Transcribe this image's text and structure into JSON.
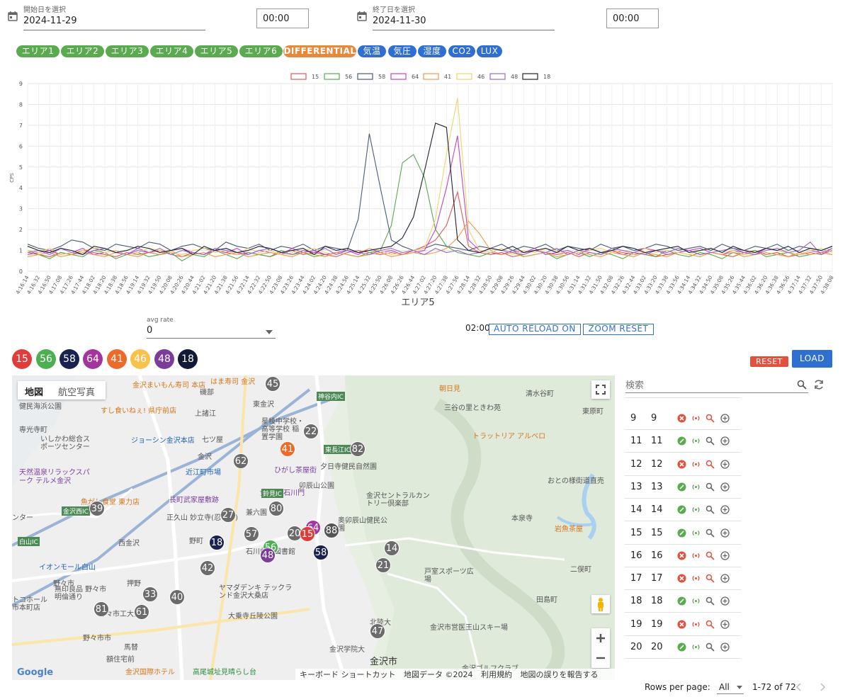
{
  "filters": {
    "start": {
      "label": "開始日を選択",
      "date": "2024-11-29",
      "time": "00:00"
    },
    "end": {
      "label": "終了日を選択",
      "date": "2024-11-30",
      "time": "00:00"
    }
  },
  "chips": [
    {
      "label": "エリア1",
      "color": "#5aaa4f"
    },
    {
      "label": "エリア2",
      "color": "#5aaa4f"
    },
    {
      "label": "エリア3",
      "color": "#5aaa4f"
    },
    {
      "label": "エリア4",
      "color": "#5aaa4f"
    },
    {
      "label": "エリア5",
      "color": "#5aaa4f"
    },
    {
      "label": "エリア6",
      "color": "#5aaa4f"
    },
    {
      "label": "DIFFERENTIAL",
      "color": "#e8893a"
    },
    {
      "label": "気温",
      "color": "#2f6fd0"
    },
    {
      "label": "気圧",
      "color": "#2f6fd0"
    },
    {
      "label": "湿度",
      "color": "#2f6fd0"
    },
    {
      "label": "CO2",
      "color": "#2f6fd0"
    },
    {
      "label": "LUX",
      "color": "#2f6fd0"
    }
  ],
  "chart_data": {
    "type": "line",
    "title": "",
    "xlabel": "エリア5",
    "ylabel": "CPS",
    "ylim": [
      0,
      9
    ],
    "grid": true,
    "legend_position": "top",
    "yticks": [
      0,
      1,
      2,
      3,
      4,
      5,
      6,
      7,
      8,
      9
    ],
    "x": [
      "4:16:14",
      "4:16:32",
      "4:16:50",
      "4:17:08",
      "4:17:26",
      "4:17:44",
      "4:18:02",
      "4:18:20",
      "4:18:38",
      "4:18:56",
      "4:19:14",
      "4:19:32",
      "4:19:50",
      "4:20:08",
      "4:20:26",
      "4:20:44",
      "4:21:02",
      "4:21:20",
      "4:21:38",
      "4:21:56",
      "4:22:14",
      "4:22:32",
      "4:22:50",
      "4:23:08",
      "4:23:26",
      "4:23:44",
      "4:24:02",
      "4:24:20",
      "4:24:38",
      "4:24:56",
      "4:25:14",
      "4:25:32",
      "4:25:50",
      "4:26:08",
      "4:26:26",
      "4:26:44",
      "4:27:02",
      "4:27:20",
      "4:27:38",
      "4:27:56",
      "4:28:14",
      "4:28:32",
      "4:28:50",
      "4:29:08",
      "4:29:26",
      "4:29:44",
      "4:30:02",
      "4:30:20",
      "4:30:38",
      "4:30:56",
      "4:31:14",
      "4:31:32",
      "4:31:50",
      "4:32:08",
      "4:32:26",
      "4:32:44",
      "4:33:02",
      "4:33:20",
      "4:33:38",
      "4:33:56",
      "4:34:14",
      "4:34:32",
      "4:34:50",
      "4:35:08",
      "4:35:26",
      "4:35:44",
      "4:36:02",
      "4:36:20",
      "4:36:38",
      "4:36:56",
      "4:37:14",
      "4:37:32",
      "4:37:50",
      "4:38:08"
    ],
    "series": [
      {
        "name": "15",
        "color": "#e8555a",
        "values": [
          0.9,
          0.8,
          0.7,
          0.9,
          0.8,
          1.0,
          0.9,
          0.8,
          0.7,
          0.9,
          0.8,
          0.9,
          1.0,
          0.8,
          0.7,
          0.9,
          0.8,
          1.0,
          0.9,
          0.8,
          0.9,
          0.8,
          0.7,
          0.9,
          1.0,
          0.8,
          0.9,
          0.8,
          0.7,
          0.9,
          1.0,
          0.9,
          0.8,
          0.9,
          0.8,
          1.0,
          1.2,
          1.5,
          2.2,
          3.8,
          1.2,
          0.9,
          0.8,
          0.9,
          0.7,
          0.8,
          1.0,
          0.9,
          0.8,
          0.9,
          0.7,
          0.9,
          0.8,
          1.0,
          0.9,
          0.8,
          0.9,
          0.7,
          0.8,
          0.9,
          1.0,
          0.8,
          0.9,
          0.8,
          0.7,
          0.9,
          1.0,
          0.8,
          0.9,
          0.7,
          0.8,
          0.9,
          0.8,
          1.0
        ]
      },
      {
        "name": "56",
        "color": "#5aaa4f",
        "values": [
          1.0,
          0.8,
          0.6,
          0.9,
          0.8,
          0.7,
          1.0,
          0.9,
          0.6,
          0.8,
          0.9,
          0.7,
          0.8,
          0.9,
          0.5,
          0.8,
          0.7,
          1.0,
          0.8,
          0.6,
          0.9,
          0.8,
          0.7,
          1.0,
          0.8,
          0.9,
          0.7,
          0.8,
          0.9,
          0.8,
          0.7,
          0.9,
          1.0,
          2.2,
          5.2,
          5.6,
          4.5,
          2.0,
          1.2,
          0.9,
          0.8,
          0.7,
          0.9,
          0.8,
          1.0,
          0.7,
          0.8,
          0.9,
          0.6,
          0.8,
          0.9,
          0.7,
          0.9,
          0.8,
          0.6,
          0.9,
          0.8,
          0.7,
          1.0,
          0.8,
          0.7,
          0.9,
          0.8,
          0.6,
          0.9,
          0.8,
          1.0,
          0.7,
          0.8,
          0.9,
          0.7,
          0.8,
          0.9,
          0.8
        ]
      },
      {
        "name": "58",
        "color": "#4a5a78",
        "values": [
          1.3,
          1.1,
          1.0,
          1.2,
          1.5,
          1.4,
          1.1,
          1.0,
          1.3,
          1.2,
          1.1,
          1.4,
          1.3,
          1.0,
          1.2,
          1.3,
          1.1,
          1.0,
          1.4,
          1.2,
          1.1,
          1.3,
          1.0,
          1.2,
          1.1,
          1.3,
          1.0,
          1.2,
          1.1,
          1.0,
          2.5,
          6.6,
          4.0,
          1.5,
          1.2,
          1.0,
          1.1,
          1.3,
          1.2,
          1.1,
          1.0,
          1.2,
          1.1,
          1.3,
          1.0,
          1.2,
          1.1,
          1.3,
          1.0,
          1.2,
          1.1,
          1.0,
          1.3,
          1.1,
          1.2,
          1.0,
          1.1,
          1.3,
          1.2,
          1.0,
          1.1,
          1.2,
          1.0,
          1.3,
          1.1,
          1.0,
          1.2,
          1.1,
          1.3,
          1.0,
          1.2,
          1.1,
          1.0,
          1.2
        ]
      },
      {
        "name": "64",
        "color": "#c046c4",
        "values": [
          0.8,
          0.9,
          1.0,
          0.8,
          0.9,
          1.1,
          0.8,
          0.9,
          1.0,
          0.8,
          1.1,
          0.9,
          0.8,
          1.0,
          1.1,
          0.9,
          0.8,
          1.0,
          0.9,
          1.1,
          0.8,
          1.0,
          0.9,
          0.8,
          1.1,
          0.9,
          1.0,
          0.8,
          0.9,
          1.0,
          0.8,
          1.1,
          0.9,
          1.0,
          0.8,
          0.9,
          1.0,
          2.0,
          4.0,
          6.5,
          1.5,
          1.0,
          0.9,
          0.8,
          1.0,
          0.9,
          1.1,
          0.8,
          0.9,
          1.0,
          0.8,
          1.1,
          0.9,
          1.0,
          0.8,
          0.9,
          1.1,
          1.0,
          0.8,
          0.9,
          1.0,
          1.1,
          0.9,
          0.8,
          1.0,
          0.9,
          0.8,
          1.1,
          1.0,
          0.9,
          0.8,
          1.0,
          0.9,
          1.1
        ]
      },
      {
        "name": "41",
        "color": "#f29a48",
        "values": [
          0.7,
          0.8,
          0.9,
          0.7,
          0.8,
          0.9,
          0.8,
          0.7,
          0.9,
          0.8,
          0.7,
          0.9,
          0.8,
          1.0,
          0.7,
          0.8,
          0.9,
          0.7,
          0.8,
          0.9,
          0.7,
          0.8,
          0.9,
          0.8,
          0.7,
          0.9,
          0.8,
          0.7,
          0.9,
          0.8,
          0.7,
          0.8,
          0.9,
          0.7,
          0.8,
          0.9,
          0.8,
          0.9,
          1.1,
          1.6,
          2.4,
          1.8,
          1.0,
          0.8,
          0.9,
          0.7,
          0.8,
          0.9,
          0.7,
          0.8,
          0.9,
          0.8,
          0.7,
          0.9,
          0.8,
          0.7,
          0.9,
          0.8,
          0.7,
          0.9,
          0.8,
          0.7,
          0.9,
          0.8,
          0.9,
          0.7,
          0.8,
          0.9,
          0.8,
          0.7,
          0.9,
          0.8,
          0.9,
          0.8
        ]
      },
      {
        "name": "46",
        "color": "#f5d26a",
        "values": [
          1.0,
          0.9,
          1.1,
          0.8,
          0.9,
          1.0,
          1.1,
          0.9,
          1.0,
          0.8,
          0.9,
          1.1,
          1.0,
          0.9,
          0.8,
          1.0,
          1.1,
          0.9,
          1.0,
          0.8,
          1.1,
          0.9,
          1.0,
          0.8,
          0.9,
          1.0,
          1.1,
          0.9,
          0.8,
          1.0,
          0.9,
          1.1,
          1.0,
          0.8,
          0.9,
          1.0,
          1.1,
          2.5,
          5.6,
          8.3,
          2.0,
          1.0,
          0.9,
          1.1,
          0.8,
          1.0,
          0.9,
          1.1,
          1.0,
          0.8,
          0.9,
          1.0,
          1.1,
          0.9,
          1.0,
          0.8,
          1.1,
          0.9,
          1.0,
          0.9,
          0.8,
          1.0,
          1.1,
          0.9,
          1.0,
          0.8,
          0.9,
          1.1,
          1.0,
          0.9,
          0.8,
          1.0,
          1.1,
          0.9
        ]
      },
      {
        "name": "48",
        "color": "#9a6ad0",
        "values": [
          0.9,
          1.0,
          0.8,
          1.1,
          0.9,
          0.8,
          1.0,
          1.1,
          0.9,
          0.8,
          1.0,
          0.9,
          1.1,
          0.8,
          1.0,
          0.9,
          0.8,
          1.1,
          1.0,
          0.9,
          0.8,
          1.0,
          1.1,
          0.9,
          0.8,
          1.0,
          0.9,
          1.1,
          0.8,
          1.0,
          0.9,
          0.8,
          1.0,
          1.1,
          0.9,
          1.0,
          0.8,
          1.1,
          0.9,
          1.0,
          0.8,
          0.9,
          1.1,
          1.0,
          0.9,
          0.8,
          1.0,
          0.9,
          1.1,
          0.8,
          1.0,
          0.9,
          0.8,
          1.1,
          1.0,
          0.9,
          0.8,
          1.0,
          0.9,
          1.1,
          1.0,
          0.8,
          0.9,
          1.0,
          1.1,
          0.9,
          0.8,
          1.0,
          1.1,
          0.9,
          1.0,
          1.4,
          0.8,
          1.1
        ]
      },
      {
        "name": "18",
        "color": "#1f2233",
        "values": [
          1.2,
          1.0,
          0.9,
          1.1,
          1.0,
          0.8,
          1.2,
          1.1,
          0.9,
          1.0,
          1.2,
          1.1,
          0.9,
          1.0,
          1.1,
          0.8,
          1.2,
          1.0,
          1.1,
          0.9,
          1.0,
          1.2,
          1.1,
          0.9,
          1.0,
          1.1,
          0.8,
          1.2,
          1.0,
          1.1,
          0.9,
          1.0,
          1.1,
          1.2,
          1.6,
          2.6,
          4.8,
          7.1,
          6.9,
          1.5,
          1.0,
          0.9,
          1.1,
          1.0,
          1.2,
          0.9,
          1.0,
          1.1,
          0.9,
          1.2,
          1.0,
          1.1,
          0.9,
          1.0,
          1.2,
          1.1,
          0.9,
          1.0,
          1.1,
          1.2,
          0.9,
          1.0,
          1.1,
          0.9,
          1.2,
          1.0,
          0.9,
          1.1,
          1.0,
          1.2,
          0.9,
          1.1,
          1.0,
          1.2
        ]
      }
    ]
  },
  "controls": {
    "avg_label": "avg rate",
    "avg_value": "0",
    "timer": "02:00",
    "auto_reload": "AUTO RELOAD ON",
    "zoom_reset": "ZOOM RESET",
    "reset": "RESET",
    "load": "LOAD"
  },
  "sensors": [
    {
      "id": "15",
      "color": "#e03c3c"
    },
    {
      "id": "56",
      "color": "#4caf50"
    },
    {
      "id": "58",
      "color": "#1a2250"
    },
    {
      "id": "64",
      "color": "#a2369c"
    },
    {
      "id": "41",
      "color": "#ee6a2b"
    },
    {
      "id": "46",
      "color": "#f7c34c"
    },
    {
      "id": "48",
      "color": "#7b3d98"
    },
    {
      "id": "18",
      "color": "#121a35"
    }
  ],
  "map": {
    "tab_map": "地図",
    "tab_aerial": "航空写真",
    "footer": {
      "keyboard": "キーボード ショートカット",
      "copyright": "地図データ ©2024",
      "terms": "利用規約",
      "report": "地図の誤りを報告する",
      "google": "Google"
    },
    "markers": [
      {
        "id": "45",
        "color": "#6b6b6b"
      },
      {
        "id": "22",
        "color": "#6b6b6b"
      },
      {
        "id": "82",
        "color": "#6b6b6b"
      },
      {
        "id": "41",
        "color": "#ee6a2b"
      },
      {
        "id": "62",
        "color": "#6b6b6b"
      },
      {
        "id": "39",
        "color": "#6b6b6b"
      },
      {
        "id": "80",
        "color": "#6b6b6b"
      },
      {
        "id": "27",
        "color": "#6b6b6b"
      },
      {
        "id": "57",
        "color": "#6b6b6b"
      },
      {
        "id": "20",
        "color": "#6b6b6b"
      },
      {
        "id": "64",
        "color": "#a2369c"
      },
      {
        "id": "15",
        "color": "#e03c3c"
      },
      {
        "id": "88",
        "color": "#555555"
      },
      {
        "id": "18",
        "color": "#1a2250"
      },
      {
        "id": "56",
        "color": "#4caf50"
      },
      {
        "id": "48",
        "color": "#7b3d98"
      },
      {
        "id": "58",
        "color": "#1a2250"
      },
      {
        "id": "14",
        "color": "#6b6b6b"
      },
      {
        "id": "21",
        "color": "#6b6b6b"
      },
      {
        "id": "42",
        "color": "#6b6b6b"
      },
      {
        "id": "33",
        "color": "#6b6b6b"
      },
      {
        "id": "40",
        "color": "#6b6b6b"
      },
      {
        "id": "81",
        "color": "#6b6b6b"
      },
      {
        "id": "61",
        "color": "#6b6b6b"
      },
      {
        "id": "47",
        "color": "#6b6b6b"
      }
    ],
    "places": [
      {
        "text": "はま寿司 金沢",
        "cls": "o"
      },
      {
        "text": "金沢まいもん寿司 本店",
        "cls": "o"
      },
      {
        "text": "健民海浜公園",
        "cls": ""
      },
      {
        "text": "すし食いねぇ! 県庁前店",
        "cls": "o"
      },
      {
        "text": "専光寺町",
        "cls": ""
      },
      {
        "text": "上諸江",
        "cls": ""
      },
      {
        "text": "東金沢",
        "cls": ""
      },
      {
        "text": "磯部",
        "cls": ""
      },
      {
        "text": "星稜中学校・高等学校 稲置学園",
        "cls": ""
      },
      {
        "text": "いしかわ総合スポーツセンター",
        "cls": ""
      },
      {
        "text": "ジョーシン金沢本店",
        "cls": "b"
      },
      {
        "text": "七ツ屋",
        "cls": ""
      },
      {
        "text": "金沢",
        "cls": ""
      },
      {
        "text": "天然温泉リラックスパーク テルメ金沢",
        "cls": "p"
      },
      {
        "text": "近江町市場",
        "cls": "b"
      },
      {
        "text": "ひがし茶屋街",
        "cls": "p"
      },
      {
        "text": "夕日寺健民自然園",
        "cls": ""
      },
      {
        "text": "卯辰山公園",
        "cls": ""
      },
      {
        "text": "金沢城 石川門",
        "cls": "p"
      },
      {
        "text": "魚がし食堂 東力店",
        "cls": "o"
      },
      {
        "text": "長町武家屋敷跡",
        "cls": "p"
      },
      {
        "text": "兼六園",
        "cls": ""
      },
      {
        "text": "正久山 妙立寺(忍者寺)",
        "cls": ""
      },
      {
        "text": "西金沢",
        "cls": ""
      },
      {
        "text": "野町",
        "cls": ""
      },
      {
        "text": "石川県立図書館",
        "cls": ""
      },
      {
        "text": "奥卯辰山健民公園",
        "cls": ""
      },
      {
        "text": "金沢セントラルカントリー倶楽部",
        "cls": ""
      },
      {
        "text": "イオンモール白山",
        "cls": "b"
      },
      {
        "text": "押野",
        "cls": ""
      },
      {
        "text": "野々市",
        "cls": ""
      },
      {
        "text": "無印良品 野々市明倫通り",
        "cls": ""
      },
      {
        "text": "ヤマダデンキ テックランド金沢大桑店",
        "cls": ""
      },
      {
        "text": "野々市市",
        "cls": ""
      },
      {
        "text": "野々市工大前",
        "cls": ""
      },
      {
        "text": "大乗寺丘陵公園",
        "cls": ""
      },
      {
        "text": "馬替",
        "cls": ""
      },
      {
        "text": "額住宅前",
        "cls": ""
      },
      {
        "text": "金沢国際ホテル",
        "cls": "o"
      },
      {
        "text": "高尾城址見晴らし台",
        "cls": "g"
      },
      {
        "text": "金沢学院大",
        "cls": ""
      },
      {
        "text": "北陸大",
        "cls": ""
      },
      {
        "text": "金沢市",
        "cls": ""
      },
      {
        "text": "戸室スポーツ広場",
        "cls": ""
      },
      {
        "text": "金沢市営医王山スキー場",
        "cls": ""
      },
      {
        "text": "金沢ゴルフクラブ",
        "cls": ""
      },
      {
        "text": "朝日見",
        "cls": "o"
      },
      {
        "text": "清水谷町",
        "cls": ""
      },
      {
        "text": "三谷の里ときわ苑",
        "cls": ""
      },
      {
        "text": "東原町",
        "cls": ""
      },
      {
        "text": "トラットリア アルベロ",
        "cls": "o"
      },
      {
        "text": "おとの様街道直売",
        "cls": ""
      },
      {
        "text": "本泉寺",
        "cls": ""
      },
      {
        "text": "岩魚茶屋",
        "cls": "o"
      },
      {
        "text": "二俣町",
        "cls": ""
      },
      {
        "text": "田島町",
        "cls": ""
      },
      {
        "text": "白山IC",
        "cls": ""
      },
      {
        "text": "金沢西IC",
        "cls": ""
      },
      {
        "text": "東長江IC",
        "cls": ""
      },
      {
        "text": "神谷内IC",
        "cls": ""
      },
      {
        "text": "鈴見IC",
        "cls": ""
      },
      {
        "text": "ンター",
        "cls": ""
      },
      {
        "text": "トコホール 市本町店",
        "cls": ""
      }
    ]
  },
  "table": {
    "search_placeholder": "検索",
    "rows": [
      {
        "a": "9",
        "b": "9",
        "ok": false
      },
      {
        "a": "11",
        "b": "11",
        "ok": true
      },
      {
        "a": "12",
        "b": "12",
        "ok": false
      },
      {
        "a": "13",
        "b": "13",
        "ok": true
      },
      {
        "a": "14",
        "b": "14",
        "ok": true
      },
      {
        "a": "15",
        "b": "15",
        "ok": true
      },
      {
        "a": "16",
        "b": "16",
        "ok": false
      },
      {
        "a": "17",
        "b": "17",
        "ok": false
      },
      {
        "a": "18",
        "b": "18",
        "ok": true
      },
      {
        "a": "19",
        "b": "19",
        "ok": false
      },
      {
        "a": "20",
        "b": "20",
        "ok": true
      }
    ],
    "rows_per_page_label": "Rows per page:",
    "rows_per_page_value": "All",
    "range": "1-72 of 72"
  }
}
